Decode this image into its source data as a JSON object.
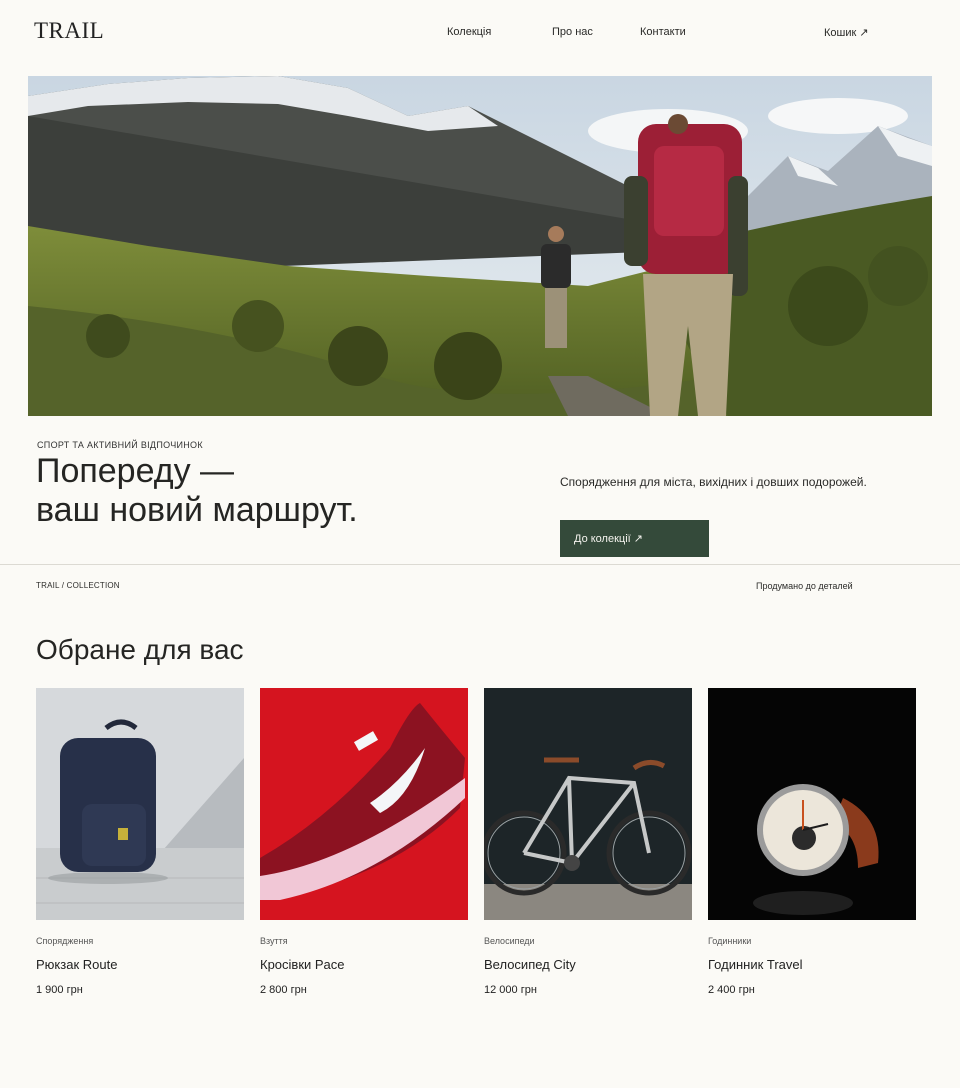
{
  "header": {
    "logo": "TRAIL",
    "nav": [
      "Колекція",
      "Про нас",
      "Контакти"
    ],
    "cart_label": "Кошик ↗"
  },
  "hero": {
    "eyebrow": "СПОРТ ТА АКТИВНИЙ ВІДПОЧИНОК",
    "headline_line1": "Попереду —",
    "headline_line2": "ваш новий маршрут.",
    "lead": "Спорядження для міста, вихідних і довших подорожей.",
    "cta_label": "До колекції ↗",
    "cta_color": "#344a3a"
  },
  "meta": {
    "left": "TRAIL / COLLECTION",
    "right": "Продумано до деталей"
  },
  "featured": {
    "title": "Обране для вас",
    "products": [
      {
        "category": "Спорядження",
        "name": "Рюкзак Route",
        "price": "1 900 грн"
      },
      {
        "category": "Взуття",
        "name": "Кросівки Pace",
        "price": "2 800 грн"
      },
      {
        "category": "Велосипеди",
        "name": "Велосипед City",
        "price": "12 000 грн"
      },
      {
        "category": "Годинники",
        "name": "Годинник Travel",
        "price": "2 400 грн"
      }
    ]
  }
}
